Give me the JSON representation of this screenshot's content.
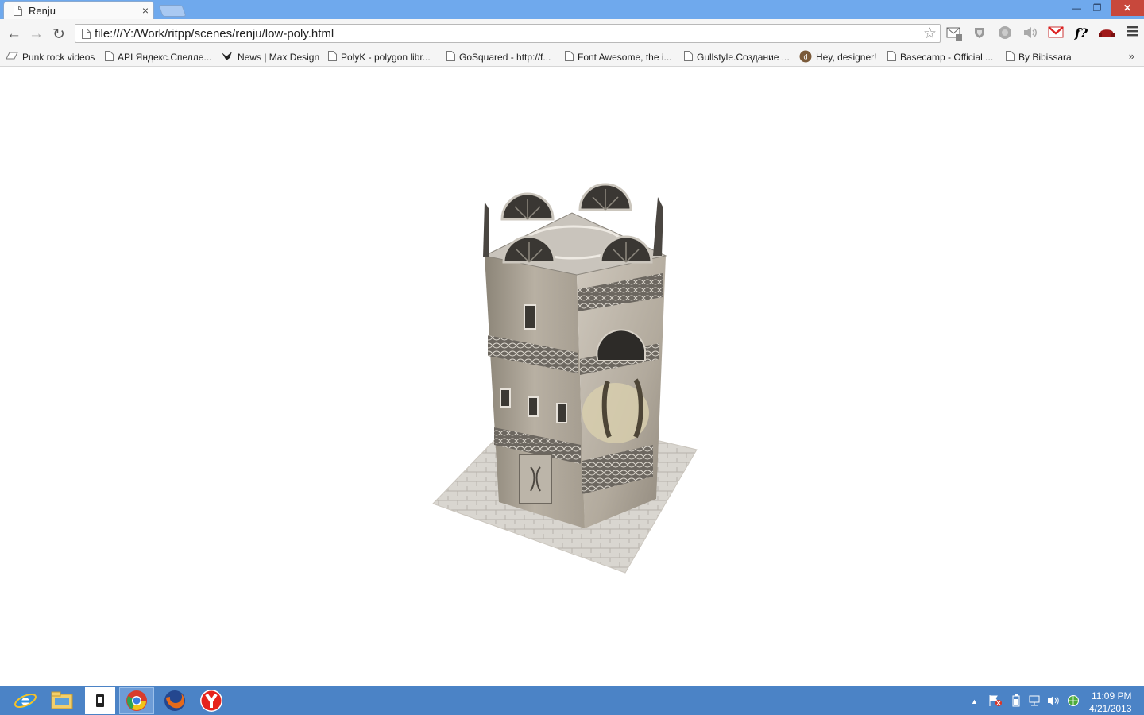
{
  "browser": {
    "tab": {
      "title": "Renju",
      "close_glyph": "×"
    },
    "window_controls": {
      "minimize": "—",
      "maximize": "❐",
      "close": "✕"
    },
    "address": "file:///Y:/Work/ritpp/scenes/renju/low-poly.html",
    "bookmark_star": "☆",
    "nav": {
      "back": "←",
      "forward": "→",
      "reload": "↻"
    },
    "extensions": [
      "mail-checker-icon",
      "shield-icon",
      "circle-extension-icon",
      "speaker-icon",
      "gmail-icon",
      "font-finder-icon",
      "sofa-icon",
      "menu-icon"
    ]
  },
  "bookmarks": {
    "items": [
      {
        "label": "Punk rock videos",
        "icon": "folder-icon"
      },
      {
        "label": "API Яндекс.Спелле...",
        "icon": "page-icon"
      },
      {
        "label": "News | Max Design",
        "icon": "bird-icon"
      },
      {
        "label": "PolyK - polygon libr...",
        "icon": "page-icon"
      },
      {
        "label": "GoSquared - http://f...",
        "icon": "page-icon"
      },
      {
        "label": "Font Awesome, the i...",
        "icon": "page-icon"
      },
      {
        "label": "Gullstyle.Создание ...",
        "icon": "page-icon"
      },
      {
        "label": "Hey, designer!",
        "icon": "avatar-icon"
      },
      {
        "label": "Basecamp - Official ...",
        "icon": "page-icon"
      },
      {
        "label": "By Bibissara",
        "icon": "page-icon"
      }
    ],
    "more": "»"
  },
  "scene": {
    "object": "low-poly textured tower"
  },
  "taskbar": {
    "apps": [
      "internet-explorer-icon",
      "file-explorer-icon",
      "tablet-app-icon",
      "chrome-icon",
      "firefox-icon",
      "yandex-browser-icon"
    ],
    "tray": {
      "chevron": "▲"
    },
    "clock": {
      "time": "11:09 PM",
      "date": "4/21/2013"
    }
  },
  "colors": {
    "titlebar": "#6fa9ed",
    "taskbar": "#4b83c6",
    "close_button": "#c8483c"
  }
}
